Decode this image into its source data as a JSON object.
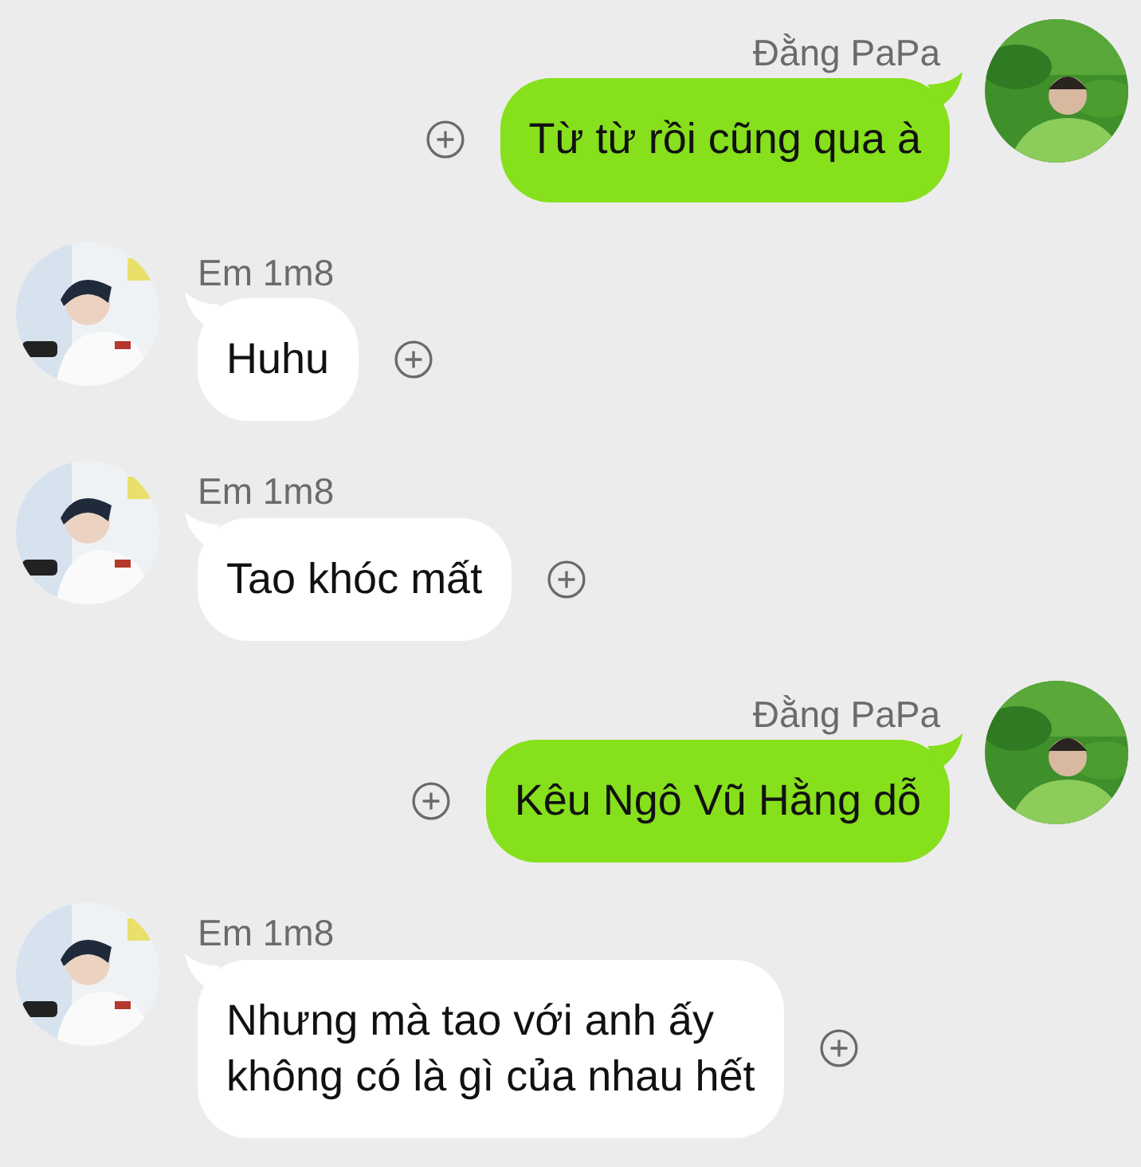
{
  "messages": [
    {
      "kind": "sent",
      "sender": "Đằng PaPa",
      "text": "Từ từ rồi cũng qua à"
    },
    {
      "kind": "received",
      "sender": "Em 1m8",
      "text": "Huhu"
    },
    {
      "kind": "received",
      "sender": "Em 1m8",
      "text": "Tao khóc mất"
    },
    {
      "kind": "sent",
      "sender": "Đằng PaPa",
      "text": "Kêu Ngô Vũ Hằng dỗ"
    },
    {
      "kind": "received",
      "sender": "Em 1m8",
      "text": "Nhưng mà tao với anh ấy\nkhông có là gì của nhau hết"
    }
  ]
}
